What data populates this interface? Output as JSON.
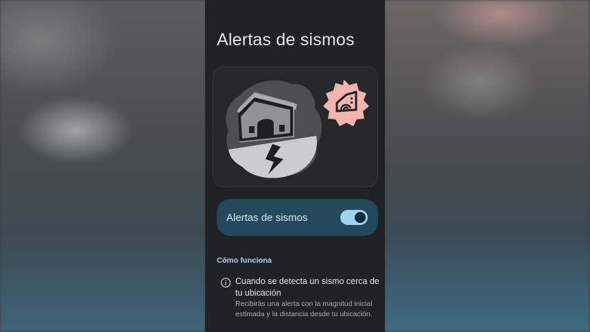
{
  "screen": {
    "title": "Alertas de sismos"
  },
  "illustration": {
    "house_icon": "house-earthquake-icon",
    "badge_icon": "house-signal-icon",
    "badge_color": "#f2b4ad"
  },
  "toggle": {
    "label": "Alertas de sismos",
    "enabled": true,
    "track_color": "#9fd4ef",
    "card_color": "#24495e"
  },
  "how_it_works": {
    "header": "Cómo funciona",
    "items": [
      {
        "icon": "info-icon",
        "title": "Cuando se detecta un sismo cerca de tu ubicación",
        "description": "Recibirás una alerta con la magnitud inicial estimada y la distancia desde tu ubicación."
      }
    ]
  }
}
